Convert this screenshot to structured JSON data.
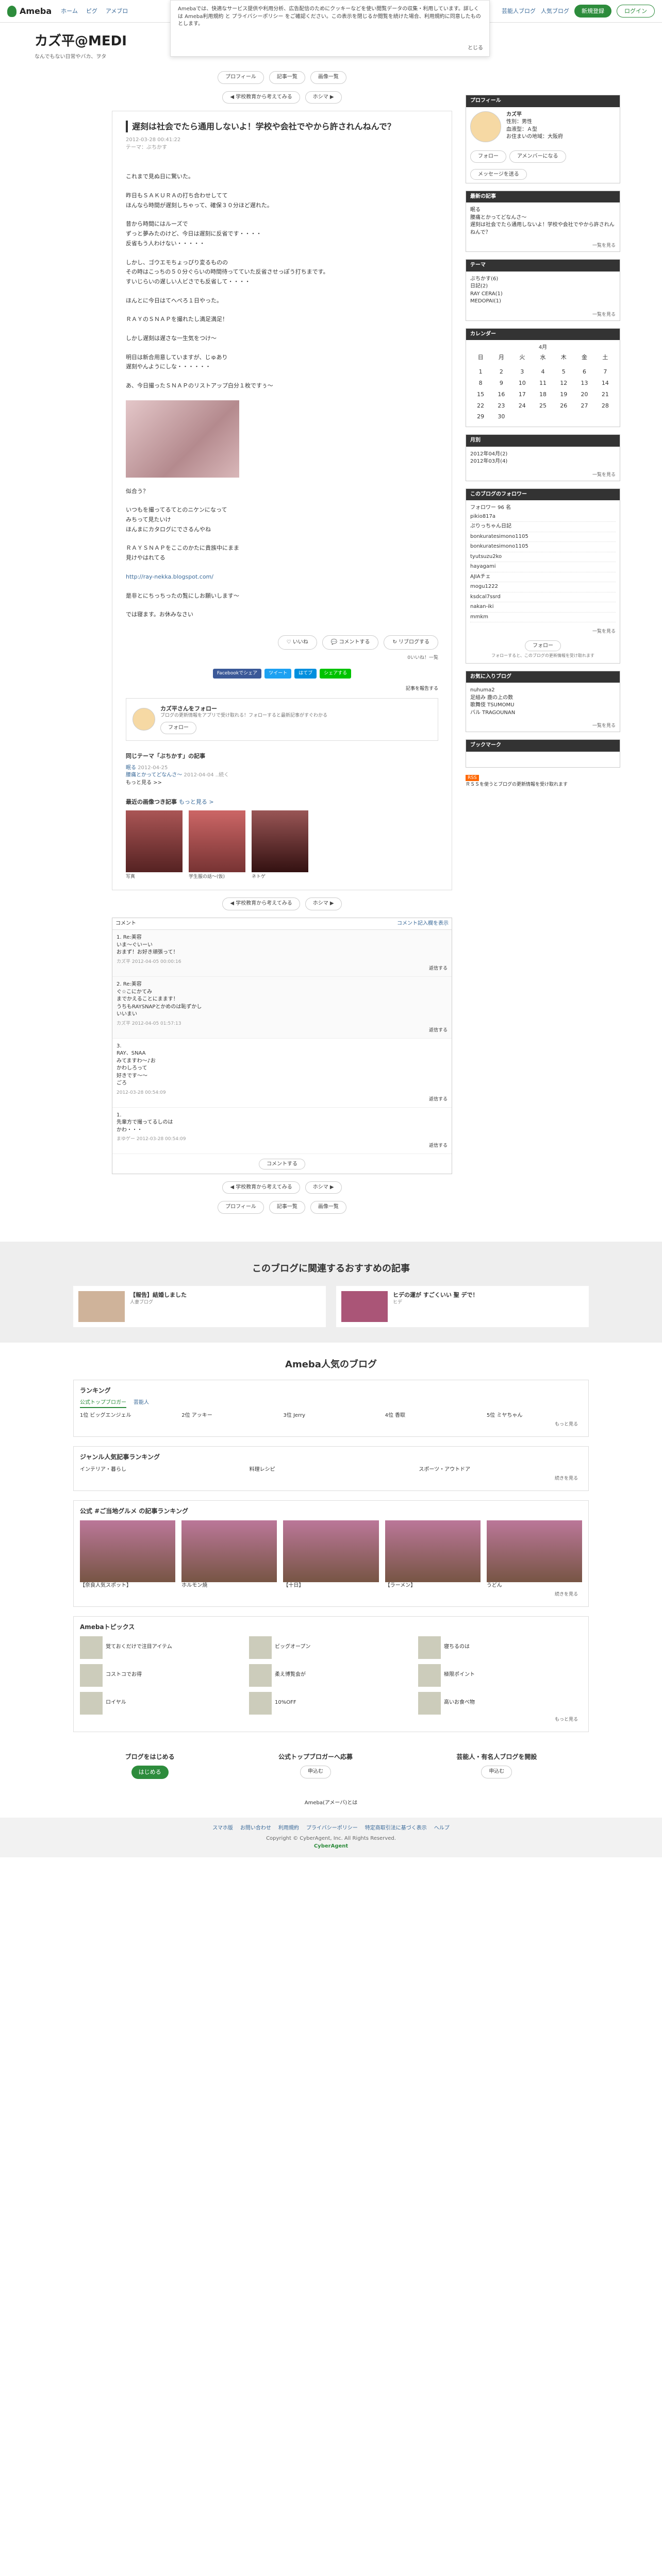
{
  "topbar": {
    "logo": "Ameba",
    "nav": [
      "ホーム",
      "ピグ",
      "アメブロ"
    ],
    "right_links": [
      "芸能人ブログ",
      "人気ブログ"
    ],
    "register": "新規登録",
    "login": "ログイン"
  },
  "cookie": {
    "text": "Amebaでは、快適なサービス提供や利用分析、広告配信のためにクッキーなどを使い閲覧データの収集・利用しています。詳しくは Ameba利用規約 と プライバシーポリシー をご確認ください。この表示を閉じるか閲覧を続けた場合、利用規約に同意したものとします。",
    "close": "とじる"
  },
  "blog": {
    "title": "カズ平@MEDI",
    "desc": "なんでもない日常やバカ、ヲタ"
  },
  "entry_nav": {
    "profile": "プロフィール",
    "list": "記事一覧",
    "photo": "画像一覧",
    "prev": "◀ 学校教育から考えてみる",
    "next": "ホシマ ▶"
  },
  "article": {
    "title": "遅刻は社会でたら通用しないよ！学校や会社でやから許されんねんで？",
    "date": "2012-03-28 00:41:22",
    "theme": "テーマ：ぶちかす",
    "paragraphs": [
      "これまで見ぬ日に驚いた。",
      "昨日もＳＡＫＵＲＡの打ち合わせしてて\nほんなら時間が遅刻しちゃって、確保３０分ほど遅れた。",
      "昔から時間にはルーズで\nずっと夢みたのけど、今日は遅刻に反省です・・・・\n反省もう人わけない・・・・・",
      "しかし、ゴウエモちょっぴり変るものの\nその時はこっちの５０分ぐらいの時間待ってていた反省させっぽう打ちまです。\nすいじらいの遅しい人ビさでも反省して・・・・",
      "ほんとに今日はてへぺろ１日やった。",
      "ＲＡＹのＳＮＡＰを撮れたし満足満足！",
      "しかし遅刻は遅さな一生気をつけ〜",
      "明日は新合用意していますが、じゅあり\n遅刻やんようにしな・・・・・・",
      "あ、今日撮ったＳＮＡＰのリストアップ白分１枚ですぅ〜"
    ],
    "paragraphs2": [
      "似合う？",
      "いつもを撮ってるてとのニケンになって\nみちって見たいけ\nほんまにカタログにでさるんやね",
      "ＲＡＹＳＮＡＰをここのかたに貴族中にまま\n見けやはれてる",
      "http://ray-nekka.blogspot.com/",
      "是非とにちっちったの覧にしお願いします〜",
      "では寝ます。お休みなさい"
    ],
    "react_like": "いいね",
    "react_comment": "コメントする",
    "react_reblog": "リブログする",
    "like_count": "0いいね！一覧",
    "share": [
      "Facebookでシェア",
      "ツイート",
      "はてブ",
      "シェアする"
    ],
    "report": "記事を報告する"
  },
  "follow": {
    "name": "カズ平さんをフォロー",
    "sub": "ブログの更新情報をアプリで受け取れる！フォローすると最新記事がすぐわかる",
    "btn": "フォロー"
  },
  "related": {
    "title": "同じテーマ「ぶちかす」の記事",
    "items": [
      {
        "t": "眠る",
        "d": "2012-04-25"
      },
      {
        "t": "腰痛とかってどなんさ〜",
        "d": "2012-04-04 ..続く"
      },
      {
        "t": "もっと見る >>",
        "d": ""
      }
    ]
  },
  "latest": {
    "title": "最近の画像つき記事",
    "more": "もっと見る >",
    "items": [
      {
        "cap": "写真"
      },
      {
        "cap": "学生服の話〜(仮)"
      },
      {
        "cap": "ネトゲ"
      }
    ]
  },
  "comments": {
    "head": "コメント",
    "open_all": "コメント記入欄を表示",
    "list": [
      {
        "n": "1. Re:美容",
        "b": "いま〜ぐいーい\nおまず！お好き頑張って！",
        "w": "カズ平 2012-04-05 00:00:16",
        "r": "返信する"
      },
      {
        "n": "2. Re:美容",
        "b": "ぐ☆こにかてみ\nまでかえることにまます！\nうちもRAYSNAPとかめのは恥ずかし\nいいまい",
        "w": "カズ平 2012-04-05 01:57:13",
        "r": "返信する"
      },
      {
        "n": "3.",
        "b": "RAY、SNAA\nみてますわ〜♪お\nかわしろって\n好きです〜〜\nごろ",
        "w": "2012-03-28 00:54:09",
        "r": "返信する"
      },
      {
        "n": "1.",
        "b": "先輩方で撮ってるしのは\nかわ・・・",
        "w": "まゆゲー 2012-03-28 00:54:09",
        "r": "返信する"
      }
    ],
    "write": "コメントする"
  },
  "sidebar": {
    "profile_h": "プロフィール",
    "profile_name": "カズ平",
    "profile_lines": [
      "性別：男性",
      "血液型：Ａ型",
      "お住まいの地域：大阪府"
    ],
    "follow_btn": "フォロー",
    "amember_btn": "アメンバーになる",
    "message_btn": "メッセージを送る",
    "recent_h": "最新の記事",
    "recent": [
      "眠る",
      "腰痛とかってどなんさ〜",
      "遅刻は社会でたら通用しないよ！学校や会社でやから許されんねんで？"
    ],
    "recent_more": "一覧を見る",
    "theme_h": "テーマ",
    "themes": [
      "ぶちかす(6)",
      "日記(2)",
      "RAY CERA(1)",
      "MEDOPAI(1)"
    ],
    "theme_more": "一覧を見る",
    "cal_h": "カレンダー",
    "cal_month": "4月",
    "cal_days": [
      "日",
      "月",
      "火",
      "水",
      "木",
      "金",
      "土"
    ],
    "cal_rows": [
      [
        "",
        "",
        "",
        "",
        "",
        "",
        ""
      ],
      [
        "1",
        "2",
        "3",
        "4",
        "5",
        "6",
        "7"
      ],
      [
        "8",
        "9",
        "10",
        "11",
        "12",
        "13",
        "14"
      ],
      [
        "15",
        "16",
        "17",
        "18",
        "19",
        "20",
        "21"
      ],
      [
        "22",
        "23",
        "24",
        "25",
        "26",
        "27",
        "28"
      ],
      [
        "29",
        "30",
        "",
        "",
        "",
        "",
        ""
      ]
    ],
    "arch_h": "月別",
    "arch": [
      "2012年04月(2)",
      "2012年03月(4)"
    ],
    "arch_more": "一覧を見る",
    "fol_h": "このブログのフォロワー",
    "fol_count": "フォロワー 96 名",
    "followers": [
      "pikio817a",
      "ぷりっちゃん日記",
      "bonkuratesimono1105",
      "bonkuratesimono1105",
      "tyutsuzu2ko",
      "hayagami",
      "AJIAチェ",
      "mogu1222",
      "ksdcal7ssrd",
      "nakan-iki",
      "mmkm"
    ],
    "fol_more": "一覧を見る",
    "fol_btn": "フォロー",
    "fol_note": "フォローすると、このブログの更新情報を受け取れます",
    "fav_h": "お気に入りブログ",
    "favs": [
      "nuhuma2",
      "足組み 鹿の上の数",
      "歌舞伎 TSUMOMU",
      "バル TRAGOUNAN"
    ],
    "fav_more": "一覧を見る",
    "book_h": "ブックマーク",
    "rss": "RSS",
    "rss_note": "ＲＳＳを使うとブログの更新情報を受け取れます"
  },
  "recommend": {
    "title": "このブログに関連するおすすめの記事",
    "cards": [
      {
        "t": "【報告】結婚しました",
        "s": "人妻ブログ"
      },
      {
        "t": "ヒデの運が すごくいい 聖 デで！",
        "s": "ヒデ"
      }
    ]
  },
  "ameba": {
    "title": "Ameba人気のブログ",
    "ranking_h": "ランキング",
    "ranking_tabs": [
      "公式トップブロガー",
      "芸能人"
    ],
    "ranking": [
      "1位 ビッグエンジェル",
      "2位 アッキー",
      "3位 Jerry",
      "4位 香取",
      "5位 ミヤちゃん"
    ],
    "ranking_more": "もっと見る",
    "genre_h": "ジャンル人気記事ランキング",
    "genre_cols": [
      "インテリア・暮らし",
      "料理レシピ",
      "スポーツ・アウトドア"
    ],
    "genre_more": "続きを見る",
    "photo_h": "公式 #ご当地グルメ の記事ランキング",
    "photo_items": [
      "【奈良人気スポット】",
      "ホルモン焼",
      "【十日】",
      "【ラーメン】",
      "うどん"
    ],
    "photo_more": "続きを見る",
    "topics_h": "Amebaトピックス",
    "topics": [
      "覚ておくだけで注目アイテム",
      "ビッグオープン",
      "寝ちるのは",
      "コストコでお得",
      "柔え博覧会が",
      "極限ポイント",
      "ロイヤル",
      "10%OFF",
      "高いお食べ物"
    ],
    "topics_more": "もっと見る"
  },
  "cta": {
    "items": [
      {
        "t": "ブログをはじめる",
        "b": "はじめる"
      },
      {
        "t": "公式トップブロガーへ応募",
        "b": "申込む"
      },
      {
        "t": "芸能人・有名人ブログを開設",
        "b": "申込む"
      }
    ],
    "sub": "Ameba(アメーバ)とは"
  },
  "footer": {
    "links": [
      "スマホ版",
      "お問い合わせ",
      "利用規約",
      "プライバシーポリシー",
      "特定商取引法に基づく表示",
      "ヘルプ"
    ],
    "copy": "Copyright © CyberAgent, Inc. All Rights Reserved.",
    "brand": "CyberAgent"
  }
}
